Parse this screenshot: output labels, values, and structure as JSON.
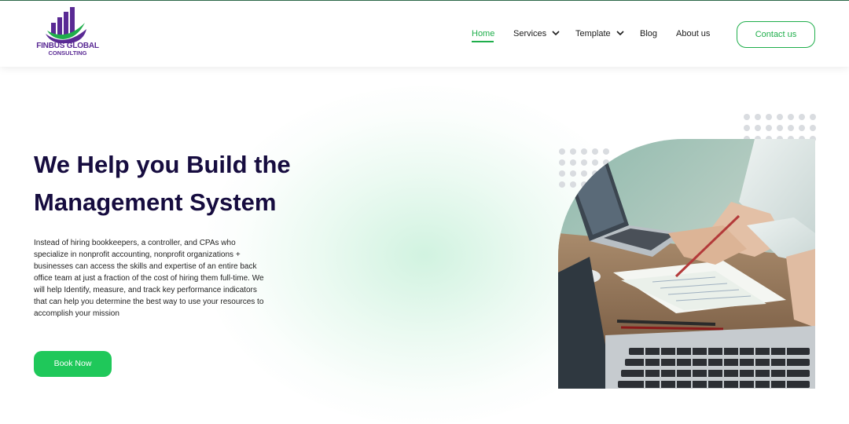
{
  "brand": {
    "line1": "FINBUS GLOBAL",
    "line2": "CONSULTING",
    "colors": {
      "purple": "#5a2a94",
      "green": "#1fae4b"
    }
  },
  "nav": {
    "home": "Home",
    "services": "Services",
    "template": "Template",
    "blog": "Blog",
    "about": "About us",
    "contact": "Contact us"
  },
  "hero": {
    "title_line1": "We Help you Build the",
    "title_line2": "Management System",
    "description": "Instead of hiring bookkeepers, a controller, and CPAs who specialize in nonprofit accounting, nonprofit organizations + businesses can access the skills and expertise of an entire back office team at just a fraction of the cost of hiring them full-time. We will help Identify, measure, and track key performance indicators that can help you determine the best way to use your resources to accomplish your mission",
    "cta": "Book Now"
  },
  "colors": {
    "accent": "#1fc85a",
    "heading": "#160c3f",
    "dot": "#d9dce0"
  },
  "icons": [
    "chevron-down-icon",
    "logo-bars-icon",
    "decorative-dots"
  ]
}
